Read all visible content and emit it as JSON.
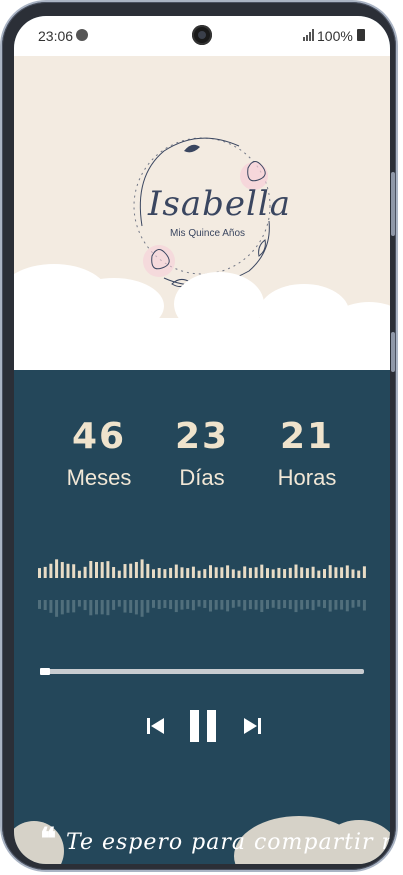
{
  "status_bar": {
    "time": "23:06",
    "battery": "100%"
  },
  "header": {
    "name": "Isabella",
    "subtitle": "Mis Quince Años"
  },
  "countdown": [
    {
      "value": "46",
      "label": "Meses"
    },
    {
      "value": "23",
      "label": "Días"
    },
    {
      "value": "21",
      "label": "Horas"
    }
  ],
  "player": {
    "progress": 0.03
  },
  "quote": {
    "mark": "❝",
    "text": "Te espero para compartir mi"
  },
  "colors": {
    "header_bg": "#f3ebe1",
    "main_bg": "#24475a",
    "accent": "#efe3cc"
  }
}
